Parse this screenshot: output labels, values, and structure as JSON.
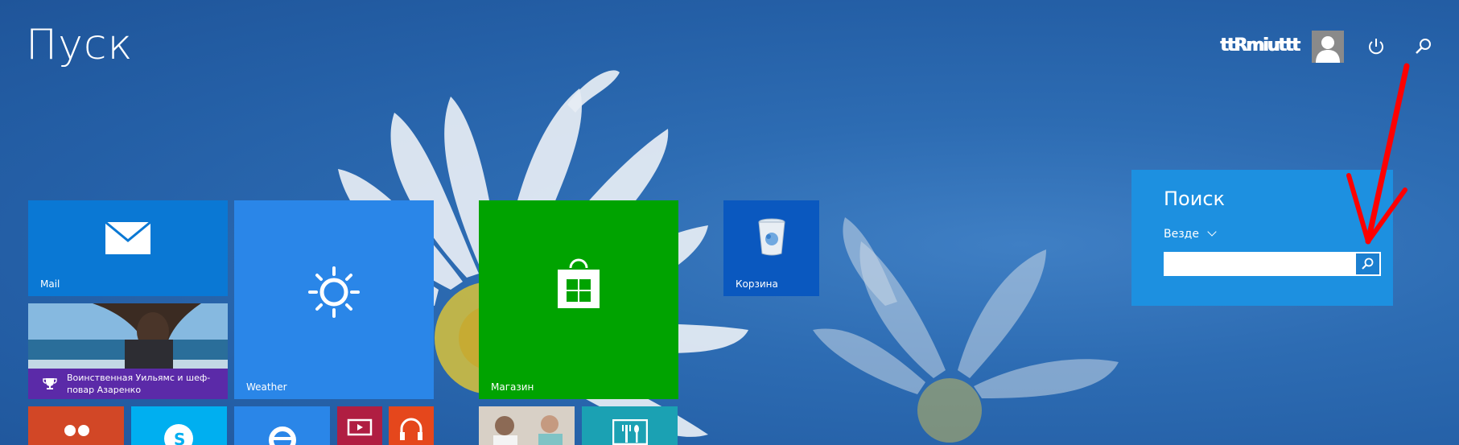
{
  "start": {
    "title": "Пуск"
  },
  "user": {
    "name": "ttRmiuttt"
  },
  "colors": {
    "desktop": "#2d6cb3",
    "mail": "#0a78d4",
    "weather": "#2a86e8",
    "store": "#00a300",
    "recycle": "#0a58bf",
    "search_panel": "#1d90e0",
    "arrow": "#ff0000"
  },
  "tiles": {
    "mail": {
      "label": "Mail",
      "icon": "mail-icon"
    },
    "weather": {
      "label": "Weather",
      "icon": "sun-icon"
    },
    "store": {
      "label": "Магазин",
      "icon": "store-bag-icon"
    },
    "recycle": {
      "label": "Корзина",
      "icon": "recycle-bin-icon"
    },
    "news": {
      "caption": "Воинственная Уильямс и шеф-повар Азаренко",
      "icon": "trophy-icon"
    }
  },
  "search": {
    "title": "Поиск",
    "scope": "Везде",
    "input_value": "",
    "button_icon": "search-icon"
  },
  "icons": {
    "top_bar": [
      "user-avatar-icon",
      "power-icon",
      "search-icon"
    ],
    "bottom_row": [
      "people-icon",
      "skype-icon",
      "internet-explorer-icon",
      "video-icon",
      "music-icon",
      "health-icon",
      "food-icon"
    ]
  }
}
